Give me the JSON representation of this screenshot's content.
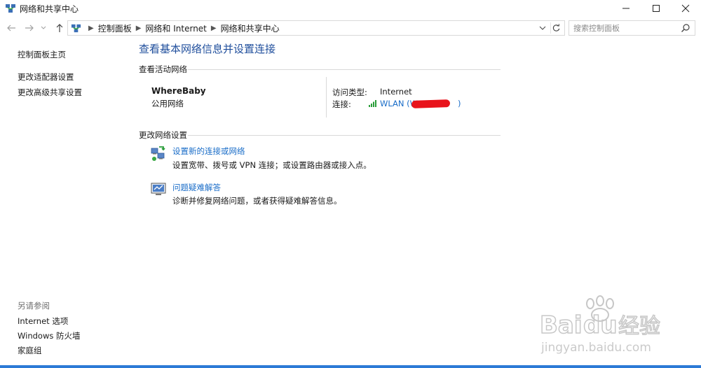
{
  "window": {
    "title": "网络和共享中心"
  },
  "nav": {
    "breadcrumbs": [
      "控制面板",
      "网络和 Internet",
      "网络和共享中心"
    ]
  },
  "search": {
    "placeholder": "搜索控制面板"
  },
  "sidebar": {
    "home": "控制面板主页",
    "links": [
      "更改适配器设置",
      "更改高级共享设置"
    ],
    "see_also_heading": "另请参阅",
    "see_also": [
      "Internet 选项",
      "Windows 防火墙",
      "家庭组"
    ]
  },
  "main": {
    "title": "查看基本网络信息并设置连接",
    "active_heading": "查看活动网络",
    "network": {
      "name": "WhereBaby",
      "type": "公用网络",
      "access_label": "访问类型:",
      "access_value": "Internet",
      "connection_label": "连接:",
      "connection_value": "WLAN (W",
      "connection_suffix": ")"
    },
    "change_heading": "更改网络设置",
    "tasks": [
      {
        "link": "设置新的连接或网络",
        "desc": "设置宽带、拨号或 VPN 连接；或设置路由器或接入点。",
        "icon": "network-setup-icon"
      },
      {
        "link": "问题疑难解答",
        "desc": "诊断并修复网络问题，或者获得疑难解答信息。",
        "icon": "troubleshoot-icon"
      }
    ]
  },
  "watermark": {
    "brand": "Baidu经验",
    "url": "jingyan.baidu.com"
  },
  "colors": {
    "title_blue": "#1f4e9c",
    "link_blue": "#1a6dc8",
    "redaction": "#e8131b"
  }
}
